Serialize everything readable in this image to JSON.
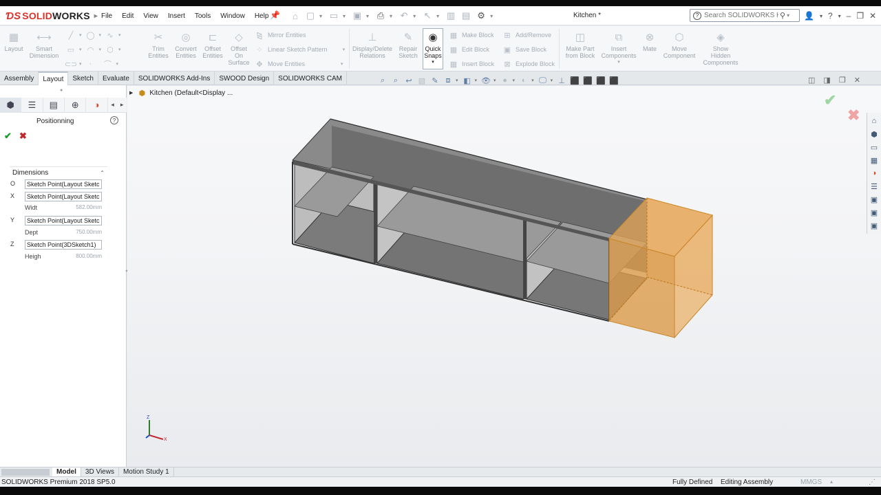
{
  "app": {
    "brand_prefix": "SOLID",
    "brand_suffix": "WORKS",
    "document_title": "Kitchen *"
  },
  "menu": [
    "File",
    "Edit",
    "View",
    "Insert",
    "Tools",
    "Window",
    "Help"
  ],
  "search": {
    "placeholder": "Search SOLIDWORKS Help"
  },
  "ribbon": {
    "layout": "Layout",
    "smart_dimension": "Smart\nDimension",
    "trim_entities": "Trim\nEntities",
    "convert_entities": "Convert\nEntities",
    "offset_entities": "Offset\nEntities",
    "offset_on_surface": "Offset\nOn\nSurface",
    "mirror_entities": "Mirror Entities",
    "linear_sketch_pattern": "Linear Sketch Pattern",
    "move_entities": "Move Entities",
    "display_delete_relations": "Display/Delete\nRelations",
    "repair_sketch": "Repair\nSketch",
    "quick_snaps": "Quick\nSnaps",
    "make_block": "Make Block",
    "edit_block": "Edit Block",
    "insert_block": "Insert Block",
    "add_remove": "Add/Remove",
    "save_block": "Save Block",
    "explode_block": "Explode Block",
    "make_part_from_block": "Make Part\nfrom Block",
    "insert_components": "Insert\nComponents",
    "mate": "Mate",
    "move_component": "Move\nComponent",
    "show_hidden_components": "Show\nHidden\nComponents"
  },
  "tabs": [
    "Assembly",
    "Layout",
    "Sketch",
    "Evaluate",
    "SOLIDWORKS Add-Ins",
    "SWOOD Design",
    "SOLIDWORKS CAM"
  ],
  "active_tab": "Layout",
  "property_manager": {
    "title": "Positionning",
    "group_title": "Dimensions",
    "rows": [
      {
        "axis": "O",
        "value": "Sketch Point(Layout Sketc"
      },
      {
        "axis": "X",
        "value": "Sketch Point(Layout Sketc"
      },
      {
        "label": "Widt",
        "value": "582.00mm"
      },
      {
        "axis": "Y",
        "value": "Sketch Point(Layout Sketc"
      },
      {
        "label": "Dept",
        "value": "750.00mm"
      },
      {
        "axis": "Z",
        "value": "Sketch Point(3DSketch1)"
      },
      {
        "label": "Heigh",
        "value": "800.00mm"
      }
    ]
  },
  "tree": {
    "root_label": "Kitchen  (Default<Display ..."
  },
  "triad": {
    "x": "X",
    "y": "Y",
    "z": "Z"
  },
  "bottom_tabs": [
    "Model",
    "3D Views",
    "Motion Study 1"
  ],
  "status": {
    "product": "SOLIDWORKS Premium 2018 SP5.0",
    "state": "Fully Defined",
    "mode": "Editing Assembly",
    "units": "MMGS"
  },
  "colors": {
    "cabinet_face": "#7a7a7a",
    "cabinet_light": "#c8c8c8",
    "preview_box": "#e3a04a",
    "brand_red": "#d9322a"
  }
}
